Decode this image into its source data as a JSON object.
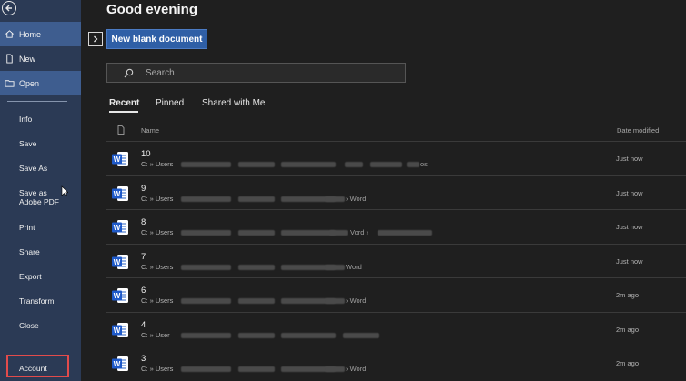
{
  "sidebar": {
    "back_icon": "arrow-left-icon",
    "primary": [
      {
        "label": "Home",
        "icon": "home-icon",
        "active": true
      },
      {
        "label": "New",
        "icon": "new-document-icon",
        "active": false
      },
      {
        "label": "Open",
        "icon": "folder-open-icon",
        "active": true
      }
    ],
    "secondary": [
      "Info",
      "Save",
      "Save As",
      "Save as Adobe PDF",
      "Print",
      "Share",
      "Export",
      "Transform",
      "Close"
    ],
    "account": "Account"
  },
  "main": {
    "greeting": "Good evening",
    "new_blank": "New blank document",
    "search_placeholder": "Search",
    "tabs": [
      "Recent",
      "Pinned",
      "Shared with Me"
    ],
    "headers": {
      "name": "Name",
      "date": "Date modified"
    },
    "rows": [
      {
        "name": "10",
        "path": "C: » Users",
        "tail": "os",
        "date": "Just now"
      },
      {
        "name": "9",
        "path": "C: » Users",
        "tail": "› Word",
        "date": "Just now"
      },
      {
        "name": "8",
        "path": "C: » Users",
        "tail": "Vord ›",
        "date": "Just now"
      },
      {
        "name": "7",
        "path": "C: » Users",
        "tail": "Word",
        "date": "Just now"
      },
      {
        "name": "6",
        "path": "C: » Users",
        "tail": "› Word",
        "date": "2m ago"
      },
      {
        "name": "4",
        "path": "C: » User",
        "tail": "",
        "date": "2m ago"
      },
      {
        "name": "3",
        "path": "C: » Users",
        "tail": "› Word",
        "date": "2m ago"
      }
    ]
  },
  "colors": {
    "sidebar": "#2b3a55",
    "active": "#3e5d8f",
    "accent": "#2f5fa6",
    "highlight": "#e24b4b"
  }
}
